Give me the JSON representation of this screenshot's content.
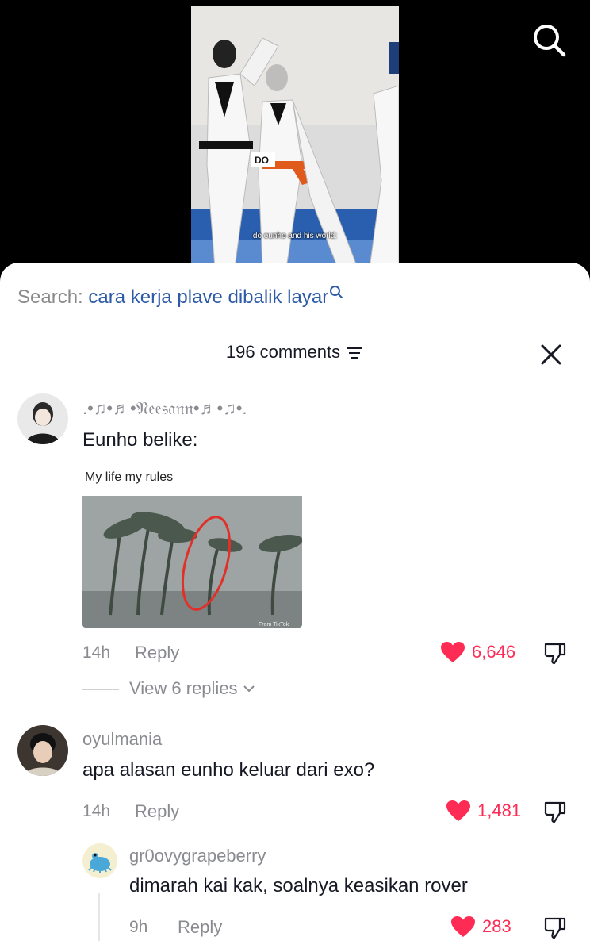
{
  "video": {
    "caption": "do eunho and his world:",
    "badge_text": "DO"
  },
  "search_banner": {
    "prefix": "Search:",
    "query": "cara kerja plave dibalik layar"
  },
  "header": {
    "comments_count": "196 comments"
  },
  "comments": [
    {
      "username": ".•♫•♬•𝔑𝔢𝔢𝔰𝔞𝔫𝔫•♬•♫•.",
      "text": "Eunho belike:",
      "image_caption": "My life my rules",
      "image_watermark": "From TikTok",
      "time": "14h",
      "reply_label": "Reply",
      "likes": "6,646",
      "view_replies": "View 6 replies"
    },
    {
      "username": "oyulmania",
      "text": "apa alasan eunho keluar dari exo?",
      "time": "14h",
      "reply_label": "Reply",
      "likes": "1,481",
      "replies": [
        {
          "username": "gr0ovygrapeberry",
          "text": "dimarah kai kak, soalnya keasikan rover",
          "time": "9h",
          "reply_label": "Reply",
          "likes": "283"
        }
      ]
    }
  ],
  "colors": {
    "like_red": "#fe2c55",
    "search_link": "#2c5aa8",
    "muted": "#8a8b91"
  },
  "icons": [
    "search-icon",
    "filter-icon",
    "close-icon",
    "heart-icon",
    "dislike-icon",
    "chevron-down-icon"
  ]
}
